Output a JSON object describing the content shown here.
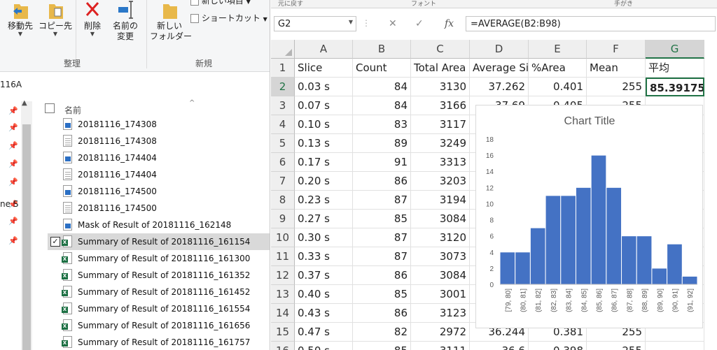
{
  "explorer": {
    "ribbon": {
      "move_to": "移動先",
      "copy_to": "コピー先",
      "delete": "削除",
      "rename_line1": "名前の",
      "rename_line2": "変更",
      "new_folder_line1": "新しい",
      "new_folder_line2": "フォルダー",
      "new_item": "新しい項目",
      "shortcut": "ショートカット",
      "group_organize": "整理",
      "group_new": "新規"
    },
    "address": "116A",
    "nav_partial_label": "ne S",
    "column_name": "名前",
    "files": [
      {
        "name": "20181116_174308",
        "icon": "image-file-icon",
        "kind": "pic"
      },
      {
        "name": "20181116_174308",
        "icon": "text-file-icon",
        "kind": "doc"
      },
      {
        "name": "20181116_174404",
        "icon": "image-file-icon",
        "kind": "pic"
      },
      {
        "name": "20181116_174404",
        "icon": "text-file-icon",
        "kind": "doc"
      },
      {
        "name": "20181116_174500",
        "icon": "image-file-icon",
        "kind": "pic"
      },
      {
        "name": "20181116_174500",
        "icon": "text-file-icon",
        "kind": "doc"
      },
      {
        "name": "Mask of Result of 20181116_162148",
        "icon": "image-file-icon",
        "kind": "pic"
      },
      {
        "name": "Summary of Result of 20181116_161154",
        "icon": "excel-file-icon",
        "kind": "xls",
        "selected": true
      },
      {
        "name": "Summary of Result of 20181116_161300",
        "icon": "excel-file-icon",
        "kind": "xls"
      },
      {
        "name": "Summary of Result of 20181116_161352",
        "icon": "excel-file-icon",
        "kind": "xls"
      },
      {
        "name": "Summary of Result of 20181116_161452",
        "icon": "excel-file-icon",
        "kind": "xls"
      },
      {
        "name": "Summary of Result of 20181116_161554",
        "icon": "excel-file-icon",
        "kind": "xls"
      },
      {
        "name": "Summary of Result of 20181116_161656",
        "icon": "excel-file-icon",
        "kind": "xls"
      },
      {
        "name": "Summary of Result of 20181116_161757",
        "icon": "excel-file-icon",
        "kind": "xls"
      }
    ]
  },
  "excel": {
    "top_strip": {
      "undo_group": "元に戻す",
      "font_group": "フォント",
      "align_group": "手がき"
    },
    "name_box": "G2",
    "formula": "=AVERAGE(B2:B98)",
    "fx_label": "fx",
    "columns": [
      "A",
      "B",
      "C",
      "D",
      "E",
      "F",
      "G"
    ],
    "active_column": "G",
    "active_row": "2",
    "header_row": [
      "Slice",
      "Count",
      "Total Area",
      "Average Si",
      "%Area",
      "Mean",
      "平均"
    ],
    "rows": [
      {
        "n": "2",
        "cells": [
          "0.03 s",
          "84",
          "3130",
          "37.262",
          "0.401",
          "255",
          "85.39175"
        ]
      },
      {
        "n": "3",
        "cells": [
          "0.07 s",
          "84",
          "3166",
          "37.69",
          "0.405",
          "255",
          ""
        ]
      },
      {
        "n": "4",
        "cells": [
          "0.10 s",
          "83",
          "3117",
          "",
          "",
          "",
          ""
        ]
      },
      {
        "n": "5",
        "cells": [
          "0.13 s",
          "89",
          "3249",
          "",
          "",
          "",
          ""
        ]
      },
      {
        "n": "6",
        "cells": [
          "0.17 s",
          "91",
          "3313",
          "",
          "",
          "",
          ""
        ]
      },
      {
        "n": "7",
        "cells": [
          "0.20 s",
          "86",
          "3203",
          "",
          "",
          "",
          ""
        ]
      },
      {
        "n": "8",
        "cells": [
          "0.23 s",
          "87",
          "3194",
          "",
          "",
          "",
          ""
        ]
      },
      {
        "n": "9",
        "cells": [
          "0.27 s",
          "85",
          "3084",
          "",
          "",
          "",
          ""
        ]
      },
      {
        "n": "10",
        "cells": [
          "0.30 s",
          "87",
          "3120",
          "",
          "",
          "",
          ""
        ]
      },
      {
        "n": "11",
        "cells": [
          "0.33 s",
          "87",
          "3073",
          "",
          "",
          "",
          ""
        ]
      },
      {
        "n": "12",
        "cells": [
          "0.37 s",
          "86",
          "3084",
          "",
          "",
          "",
          ""
        ]
      },
      {
        "n": "13",
        "cells": [
          "0.40 s",
          "85",
          "3001",
          "",
          "",
          "",
          ""
        ]
      },
      {
        "n": "14",
        "cells": [
          "0.43 s",
          "86",
          "3123",
          "",
          "",
          "",
          ""
        ]
      },
      {
        "n": "15",
        "cells": [
          "0.47 s",
          "82",
          "2972",
          "36.244",
          "0.381",
          "255",
          ""
        ]
      },
      {
        "n": "16",
        "cells": [
          "0.50 s",
          "85",
          "3111",
          "36.6",
          "0.398",
          "255",
          ""
        ]
      }
    ]
  },
  "chart_data": {
    "type": "bar",
    "title": "Chart Title",
    "categories": [
      "[79, 80]",
      "(80, 81]",
      "(81, 82]",
      "(82, 83]",
      "(83, 84]",
      "(84, 85]",
      "(85, 86]",
      "(86, 87]",
      "(87, 88]",
      "(88, 89]",
      "(89, 90]",
      "(90, 91]",
      "(91, 92]"
    ],
    "values": [
      4,
      4,
      7,
      11,
      11,
      12,
      16,
      12,
      6,
      6,
      2,
      5,
      1
    ],
    "ylim": [
      0,
      18
    ],
    "yticks": [
      0,
      2,
      4,
      6,
      8,
      10,
      12,
      14,
      16,
      18
    ],
    "bar_color": "#4472c4",
    "grid": false,
    "legend": "none"
  }
}
